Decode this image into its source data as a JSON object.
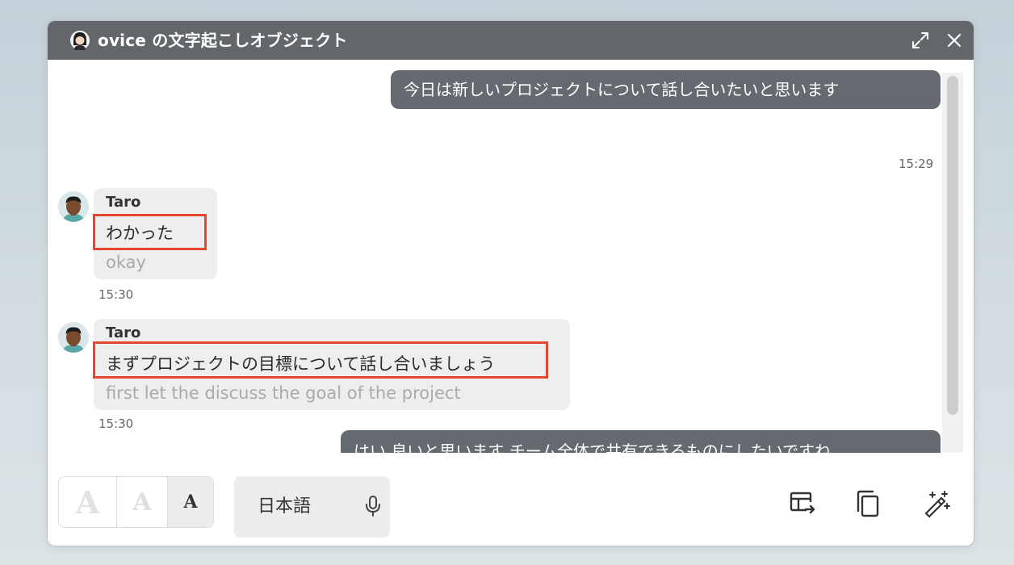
{
  "window": {
    "title": "ovice の文字起こしオブジェクト"
  },
  "messages": [
    {
      "side": "right",
      "text": "今日は新しいプロジェクトについて話し合いたいと思います",
      "time": "15:29"
    },
    {
      "side": "left",
      "sender": "Taro",
      "text": "わかった",
      "translation": "okay",
      "time": "15:30"
    },
    {
      "side": "left",
      "sender": "Taro",
      "text": "まずプロジェクトの目標について話し合いましょう",
      "translation": "first let the discuss the goal of the project",
      "time": "15:30"
    },
    {
      "side": "right",
      "text": "はい 良いと思います チーム全体で共有できるものにしたいですね"
    }
  ],
  "toolbar": {
    "font_sizes": [
      "A",
      "A",
      "A"
    ],
    "selected_font_size_index": 2,
    "language": "日本語"
  },
  "icons": {
    "title_avatar": "user-avatar-icon",
    "expand": "expand-icon",
    "close": "close-icon",
    "mic": "microphone-icon",
    "export_table": "table-export-icon",
    "copy": "copy-icon",
    "magic": "magic-wand-icon"
  },
  "colors": {
    "titlebar": "#63676b",
    "right_bubble": "#646a6f",
    "left_bubble": "#eeeef0",
    "highlight": "#e5462f"
  }
}
